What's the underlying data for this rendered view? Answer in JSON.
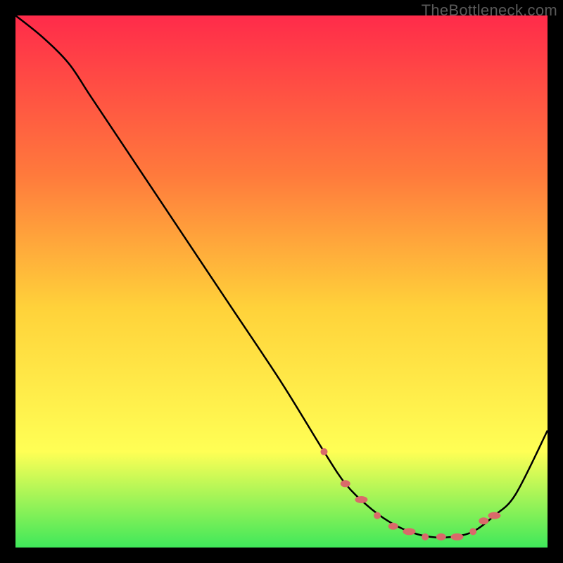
{
  "watermark": "TheBottleneck.com",
  "colors": {
    "gradient_top": "#ff2b4a",
    "gradient_mid1": "#ff7a3c",
    "gradient_mid2": "#ffd23a",
    "gradient_mid3": "#ffff55",
    "gradient_bottom": "#3fe85a",
    "curve": "#000000",
    "marker": "#d96a6a",
    "background": "#000000"
  },
  "chart_data": {
    "type": "line",
    "title": "",
    "xlabel": "",
    "ylabel": "",
    "xlim": [
      0,
      100
    ],
    "ylim": [
      0,
      100
    ],
    "series": [
      {
        "name": "bottleneck-curve",
        "x": [
          0,
          5,
          10,
          14,
          20,
          30,
          40,
          50,
          58,
          62,
          66,
          70,
          74,
          78,
          82,
          86,
          90,
          94,
          100
        ],
        "y": [
          100,
          96,
          91,
          85,
          76,
          61,
          46,
          31,
          18,
          12,
          8,
          5,
          3,
          2,
          2,
          3,
          6,
          10,
          22
        ]
      }
    ],
    "markers": {
      "name": "highlight-dots",
      "x": [
        58,
        62,
        65,
        68,
        71,
        74,
        77,
        80,
        83,
        86,
        88,
        90
      ],
      "y": [
        18,
        12,
        9,
        6,
        4,
        3,
        2,
        2,
        2,
        3,
        5,
        6
      ]
    }
  }
}
